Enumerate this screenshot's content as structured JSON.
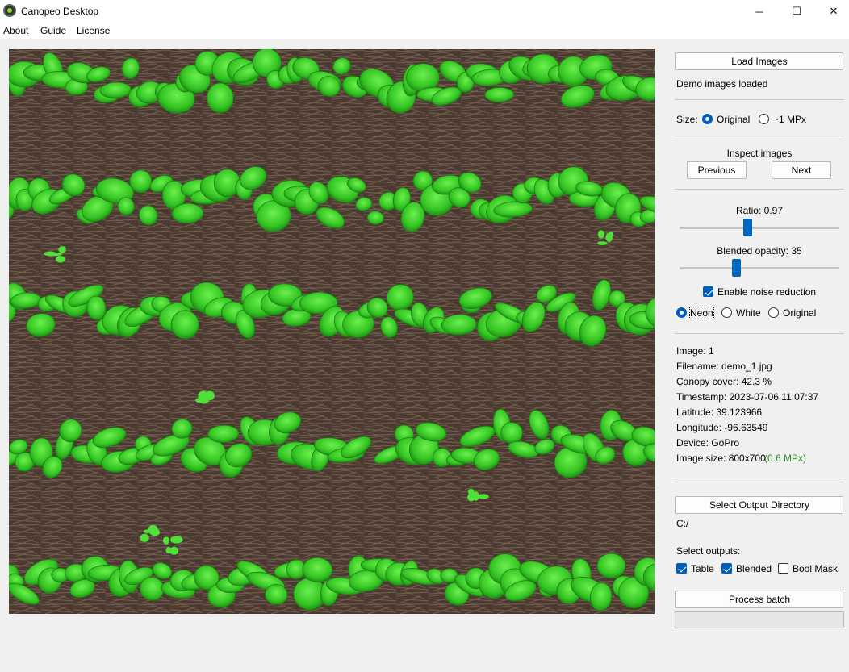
{
  "window": {
    "title": "Canopeo Desktop",
    "minimize_glyph": "─",
    "maximize_glyph": "☐",
    "close_glyph": "✕"
  },
  "menu": {
    "items": [
      "About",
      "Guide",
      "License"
    ]
  },
  "panel": {
    "load_button": "Load Images",
    "load_status": "Demo images loaded",
    "size_label": "Size:",
    "size_options": [
      "Original",
      "~1 MPx"
    ],
    "size_selected": 0,
    "inspect_label": "Inspect images",
    "previous_button": "Previous",
    "next_button": "Next",
    "ratio_label": "Ratio: 0.97",
    "ratio_level": 0.42,
    "opacity_label": "Blended opacity: 35",
    "opacity_level": 0.35,
    "noise_label": "Enable noise reduction",
    "noise_checked": true,
    "color_options": [
      "Neon",
      "White",
      "Original"
    ],
    "color_selected": 0,
    "info": {
      "image": "Image: 1",
      "filename": "Filename: demo_1.jpg",
      "canopy": "Canopy cover: 42.3 %",
      "timestamp": "Timestamp: 2023-07-06 11:07:37",
      "latitude": "Latitude: 39.123966",
      "longitude": "Longitude: -96.63549",
      "device": "Device: GoPro",
      "size": "Image size: 800x700",
      "size_mpx": "(0.6 MPx)"
    },
    "output_button": "Select Output Directory",
    "output_path": "C:/",
    "outputs_label": "Select outputs:",
    "outputs": [
      {
        "label": "Table",
        "checked": true
      },
      {
        "label": "Blended",
        "checked": true
      },
      {
        "label": "Bool Mask",
        "checked": false
      }
    ],
    "process_button": "Process batch",
    "progress_fraction": 0
  },
  "colors": {
    "soil": "#4b3a31",
    "residue": "#7a6250",
    "canopy": "#3ad22a",
    "accent": "#005fb8",
    "mpx_text": "#2e8b2e"
  }
}
